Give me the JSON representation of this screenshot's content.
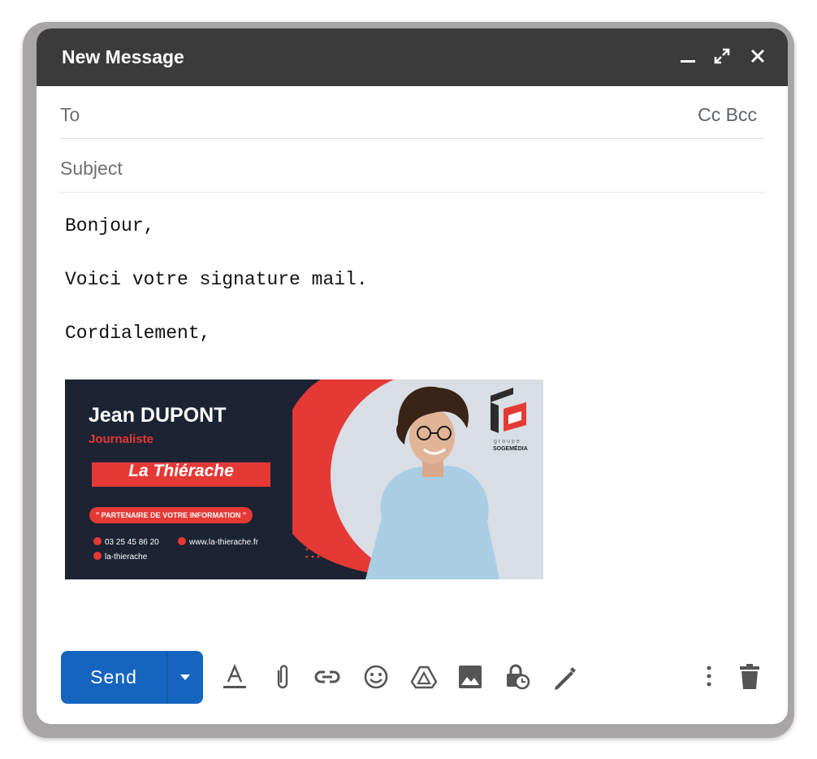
{
  "window": {
    "title": "New Message",
    "minimize_icon": "minimize-icon",
    "expand_icon": "expand-icon",
    "close_icon": "close-icon"
  },
  "to": {
    "label": "To",
    "cc": "Cc",
    "bcc": "Bcc"
  },
  "subject": {
    "label": "Subject"
  },
  "body": {
    "lines": [
      "Bonjour,",
      "Voici votre signature mail.",
      "Cordialement,"
    ]
  },
  "signature": {
    "name": "Jean DUPONT",
    "role": "Journaliste",
    "publication": "La Thiérache",
    "tagline": "\" PARTENAIRE DE VOTRE INFORMATION \"",
    "phone": "03 25 45 86 20",
    "website": "www.la-thierache.fr",
    "facebook": "la-thierache",
    "logo_small": "groupe",
    "logo_brand": "SOGEMÉDIA",
    "colors": {
      "dark": "#1c2333",
      "accent": "#e53935"
    }
  },
  "toolbar": {
    "send_label": "Send",
    "icons": [
      "format-text-icon",
      "attach-icon",
      "link-icon",
      "emoji-icon",
      "drive-icon",
      "image-icon",
      "confidential-icon",
      "signature-icon",
      "more-options-icon",
      "trash-icon"
    ]
  },
  "colors": {
    "send": "#1565c0",
    "titlebar": "#3b3b3b",
    "icon": "#555555"
  }
}
